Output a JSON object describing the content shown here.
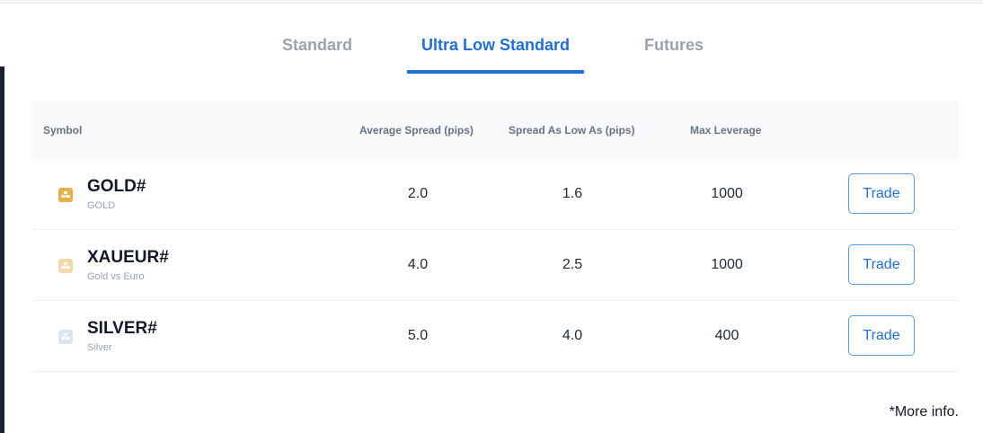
{
  "tabs": [
    {
      "label": "Standard",
      "active": false
    },
    {
      "label": "Ultra Low Standard",
      "active": true
    },
    {
      "label": "Futures",
      "active": false
    }
  ],
  "table": {
    "headers": {
      "symbol": "Symbol",
      "avg_spread": "Average Spread (pips)",
      "spread_low": "Spread As Low As (pips)",
      "max_leverage": "Max Leverage"
    },
    "rows": [
      {
        "symbol": "GOLD#",
        "description": "GOLD",
        "avg_spread": "2.0",
        "spread_low": "1.6",
        "max_leverage": "1000",
        "action": "Trade",
        "icon": "gold-bars-icon",
        "icon_color": "#e6b04a"
      },
      {
        "symbol": "XAUEUR#",
        "description": "Gold vs Euro",
        "avg_spread": "4.0",
        "spread_low": "2.5",
        "max_leverage": "1000",
        "action": "Trade",
        "icon": "gold-euro-bars-icon",
        "icon_color": "#f3d9a8"
      },
      {
        "symbol": "SILVER#",
        "description": "Silver",
        "avg_spread": "5.0",
        "spread_low": "4.0",
        "max_leverage": "400",
        "action": "Trade",
        "icon": "silver-bars-icon",
        "icon_color": "#dbe5ee"
      }
    ]
  },
  "footer": {
    "more_info": "*More info."
  },
  "colors": {
    "accent": "#1f6fd6",
    "inactive_tab": "#9aa3ad",
    "header_bg": "#f7f9fb"
  }
}
